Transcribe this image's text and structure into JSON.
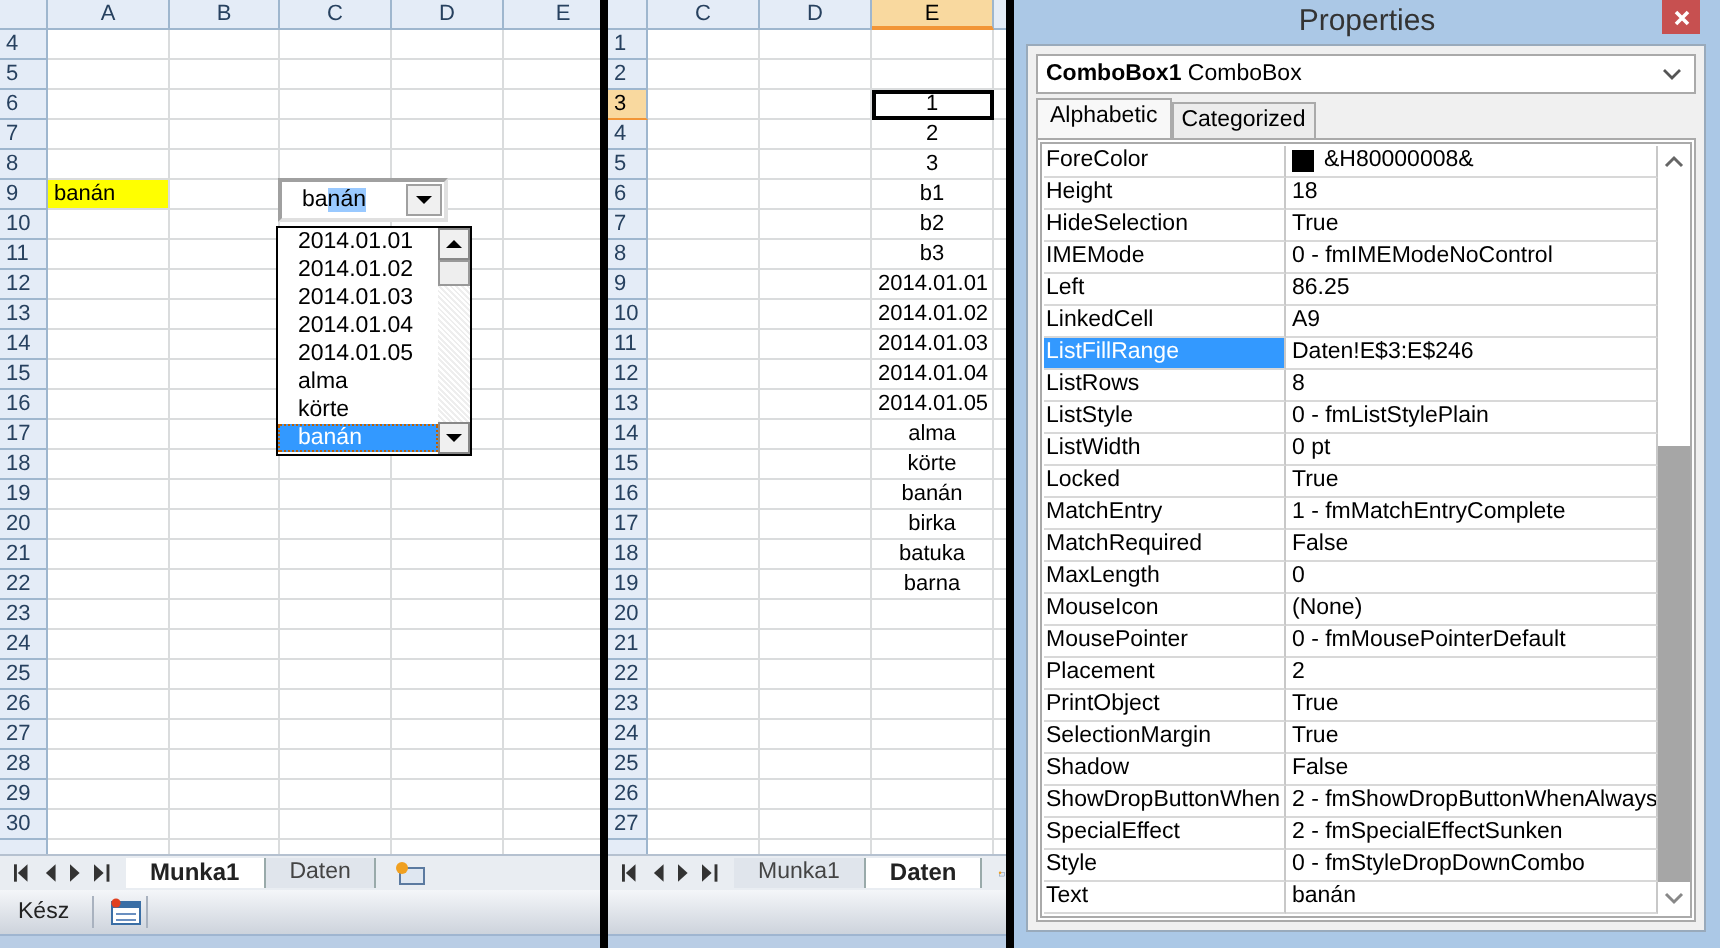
{
  "left_sheet": {
    "columns": [
      {
        "label": "A",
        "selected": false
      },
      {
        "label": "B",
        "selected": false
      },
      {
        "label": "C",
        "selected": false
      },
      {
        "label": "D",
        "selected": false
      },
      {
        "label": "E",
        "selected": false
      }
    ],
    "rows": [
      {
        "number": "4",
        "selected": false
      },
      {
        "number": "5",
        "selected": false
      },
      {
        "number": "6",
        "selected": false
      },
      {
        "number": "7",
        "selected": false
      },
      {
        "number": "8",
        "selected": false
      },
      {
        "number": "9",
        "selected": false,
        "cells": [
          {
            "text": "banán",
            "highlighted": true,
            "active": false
          }
        ]
      },
      {
        "number": "10",
        "selected": false
      },
      {
        "number": "11",
        "selected": false
      },
      {
        "number": "12",
        "selected": false
      },
      {
        "number": "13",
        "selected": false
      },
      {
        "number": "14",
        "selected": false
      },
      {
        "number": "15",
        "selected": false
      },
      {
        "number": "16",
        "selected": false
      },
      {
        "number": "17",
        "selected": false
      },
      {
        "number": "18",
        "selected": false
      },
      {
        "number": "19",
        "selected": false
      },
      {
        "number": "20",
        "selected": false
      },
      {
        "number": "21",
        "selected": false
      },
      {
        "number": "22",
        "selected": false
      },
      {
        "number": "23",
        "selected": false
      },
      {
        "number": "24",
        "selected": false
      },
      {
        "number": "25",
        "selected": false
      },
      {
        "number": "26",
        "selected": false
      },
      {
        "number": "27",
        "selected": false
      },
      {
        "number": "28",
        "selected": false
      },
      {
        "number": "29",
        "selected": false
      },
      {
        "number": "30",
        "selected": false
      }
    ],
    "combobox": {
      "value_parts": [
        {
          "text": "ba",
          "selected": false
        },
        {
          "text": "nán",
          "selected": true
        }
      ],
      "items": [
        {
          "text": "2014.01.01",
          "selected": false
        },
        {
          "text": "2014.01.02",
          "selected": false
        },
        {
          "text": "2014.01.03",
          "selected": false
        },
        {
          "text": "2014.01.04",
          "selected": false
        },
        {
          "text": "2014.01.05",
          "selected": false
        },
        {
          "text": "alma",
          "selected": false
        },
        {
          "text": "körte",
          "selected": false
        },
        {
          "text": "banán",
          "selected": true
        }
      ]
    },
    "sheet_tabs": [
      {
        "label": "Munka1",
        "selected": true
      },
      {
        "label": "Daten",
        "selected": false
      }
    ],
    "status_bar": {
      "text": "Kész"
    }
  },
  "right_sheet": {
    "columns": [
      {
        "label": "C",
        "selected": false
      },
      {
        "label": "D",
        "selected": false
      },
      {
        "label": "E",
        "selected": true
      }
    ],
    "rows": [
      {
        "number": "1",
        "selected": false
      },
      {
        "number": "2",
        "selected": false
      },
      {
        "number": "3",
        "selected": true,
        "cells": [
          {
            "text": "1",
            "highlighted": false,
            "active": true
          }
        ]
      },
      {
        "number": "4",
        "selected": false,
        "cells": [
          {
            "text": "2",
            "highlighted": false,
            "active": false
          }
        ]
      },
      {
        "number": "5",
        "selected": false,
        "cells": [
          {
            "text": "3",
            "highlighted": false,
            "active": false
          }
        ]
      },
      {
        "number": "6",
        "selected": false,
        "cells": [
          {
            "text": "b1",
            "highlighted": false,
            "active": false
          }
        ]
      },
      {
        "number": "7",
        "selected": false,
        "cells": [
          {
            "text": "b2",
            "highlighted": false,
            "active": false
          }
        ]
      },
      {
        "number": "8",
        "selected": false,
        "cells": [
          {
            "text": "b3",
            "highlighted": false,
            "active": false
          }
        ]
      },
      {
        "number": "9",
        "selected": false,
        "cells": [
          {
            "text": "2014.01.01",
            "highlighted": false,
            "active": false
          }
        ]
      },
      {
        "number": "10",
        "selected": false,
        "cells": [
          {
            "text": "2014.01.02",
            "highlighted": false,
            "active": false
          }
        ]
      },
      {
        "number": "11",
        "selected": false,
        "cells": [
          {
            "text": "2014.01.03",
            "highlighted": false,
            "active": false
          }
        ]
      },
      {
        "number": "12",
        "selected": false,
        "cells": [
          {
            "text": "2014.01.04",
            "highlighted": false,
            "active": false
          }
        ]
      },
      {
        "number": "13",
        "selected": false,
        "cells": [
          {
            "text": "2014.01.05",
            "highlighted": false,
            "active": false
          }
        ]
      },
      {
        "number": "14",
        "selected": false,
        "cells": [
          {
            "text": "alma",
            "highlighted": false,
            "active": false
          }
        ]
      },
      {
        "number": "15",
        "selected": false,
        "cells": [
          {
            "text": "körte",
            "highlighted": false,
            "active": false
          }
        ]
      },
      {
        "number": "16",
        "selected": false,
        "cells": [
          {
            "text": "banán",
            "highlighted": false,
            "active": false
          }
        ]
      },
      {
        "number": "17",
        "selected": false,
        "cells": [
          {
            "text": "birka",
            "highlighted": false,
            "active": false
          }
        ]
      },
      {
        "number": "18",
        "selected": false,
        "cells": [
          {
            "text": "batuka",
            "highlighted": false,
            "active": false
          }
        ]
      },
      {
        "number": "19",
        "selected": false,
        "cells": [
          {
            "text": "barna",
            "highlighted": false,
            "active": false
          }
        ]
      },
      {
        "number": "20",
        "selected": false
      },
      {
        "number": "21",
        "selected": false
      },
      {
        "number": "22",
        "selected": false
      },
      {
        "number": "23",
        "selected": false
      },
      {
        "number": "24",
        "selected": false
      },
      {
        "number": "25",
        "selected": false
      },
      {
        "number": "26",
        "selected": false
      },
      {
        "number": "27",
        "selected": false
      }
    ],
    "sheet_tabs": [
      {
        "label": "Munka1",
        "selected": false
      },
      {
        "label": "Daten",
        "selected": true
      }
    ]
  },
  "properties": {
    "title": "Properties",
    "object_name": "ComboBox1",
    "object_type": "ComboBox",
    "tabs": [
      {
        "label": "Alphabetic",
        "selected": true
      },
      {
        "label": "Categorized",
        "selected": false
      }
    ],
    "rows": [
      {
        "name": "ForeColor",
        "value": "&H80000008&",
        "color": "#000000",
        "selected": false
      },
      {
        "name": "Height",
        "value": "18",
        "selected": false
      },
      {
        "name": "HideSelection",
        "value": "True",
        "selected": false
      },
      {
        "name": "IMEMode",
        "value": "0 - fmIMEModeNoControl",
        "selected": false
      },
      {
        "name": "Left",
        "value": "86.25",
        "selected": false
      },
      {
        "name": "LinkedCell",
        "value": "A9",
        "selected": false
      },
      {
        "name": "ListFillRange",
        "value": "Daten!E$3:E$246",
        "selected": true
      },
      {
        "name": "ListRows",
        "value": "8",
        "selected": false
      },
      {
        "name": "ListStyle",
        "value": "0 - fmListStylePlain",
        "selected": false
      },
      {
        "name": "ListWidth",
        "value": "0 pt",
        "selected": false
      },
      {
        "name": "Locked",
        "value": "True",
        "selected": false
      },
      {
        "name": "MatchEntry",
        "value": "1 - fmMatchEntryComplete",
        "selected": false
      },
      {
        "name": "MatchRequired",
        "value": "False",
        "selected": false
      },
      {
        "name": "MaxLength",
        "value": "0",
        "selected": false
      },
      {
        "name": "MouseIcon",
        "value": "(None)",
        "selected": false
      },
      {
        "name": "MousePointer",
        "value": "0 - fmMousePointerDefault",
        "selected": false
      },
      {
        "name": "Placement",
        "value": "2",
        "selected": false
      },
      {
        "name": "PrintObject",
        "value": "True",
        "selected": false
      },
      {
        "name": "SelectionMargin",
        "value": "True",
        "selected": false
      },
      {
        "name": "Shadow",
        "value": "False",
        "selected": false
      },
      {
        "name": "ShowDropButtonWhen",
        "value": "2 - fmShowDropButtonWhenAlways",
        "selected": false
      },
      {
        "name": "SpecialEffect",
        "value": "2 - fmSpecialEffectSunken",
        "selected": false
      },
      {
        "name": "Style",
        "value": "0 - fmStyleDropDownCombo",
        "selected": false
      },
      {
        "name": "Text",
        "value": "banán",
        "selected": false
      }
    ]
  }
}
